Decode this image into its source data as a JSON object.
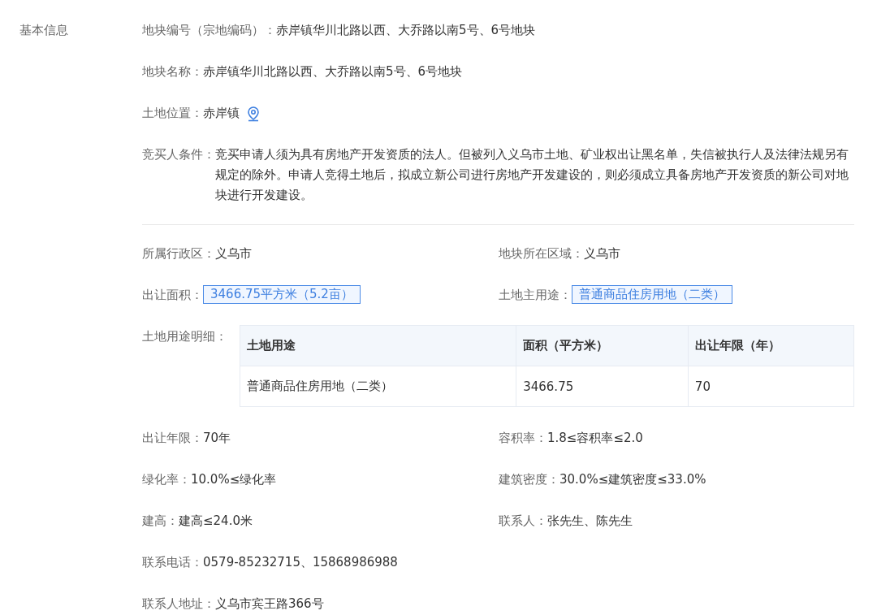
{
  "section_label": "基本信息",
  "top_fields": [
    {
      "label": "地块编号（宗地编码）：",
      "value": "赤岸镇华川北路以西、大乔路以南5号、6号地块",
      "kind": "text"
    },
    {
      "label": "地块名称：",
      "value": "赤岸镇华川北路以西、大乔路以南5号、6号地块",
      "kind": "text"
    },
    {
      "label": "土地位置：",
      "value": "赤岸镇",
      "kind": "location"
    },
    {
      "label": "竞买人条件：",
      "value": "竞买申请人须为具有房地产开发资质的法人。但被列入义乌市土地、矿业权出让黑名单，失信被执行人及法律法规另有规定的除外。申请人竞得土地后，拟成立新公司进行房地产开发建设的，则必须成立具备房地产开发资质的新公司对地块进行开发建设。",
      "kind": "text"
    }
  ],
  "grid_fields": [
    {
      "label": "所属行政区：",
      "value": "义乌市",
      "kind": "text",
      "wide": false
    },
    {
      "label": "地块所在区域：",
      "value": "义乌市",
      "kind": "text",
      "wide": false
    },
    {
      "label": "出让面积：",
      "value": "3466.75平方米（5.2亩）",
      "kind": "tag",
      "wide": false
    },
    {
      "label": "土地主用途：",
      "value": "普通商品住房用地（二类）",
      "kind": "tag",
      "wide": false
    }
  ],
  "usage_table": {
    "label": "土地用途明细：",
    "columns": [
      "土地用途",
      "面积（平方米）",
      "出让年限（年）"
    ],
    "rows": [
      [
        "普通商品住房用地（二类）",
        "3466.75",
        "70"
      ]
    ]
  },
  "more_fields": [
    {
      "label": "出让年限：",
      "value": "70年",
      "kind": "text",
      "wide": false
    },
    {
      "label": "容积率：",
      "value": "1.8≤容积率≤2.0",
      "kind": "text",
      "wide": false
    },
    {
      "label": "绿化率：",
      "value": "10.0%≤绿化率",
      "kind": "text",
      "wide": false
    },
    {
      "label": "建筑密度：",
      "value": "30.0%≤建筑密度≤33.0%",
      "kind": "text",
      "wide": false
    },
    {
      "label": "建高：",
      "value": "建高≤24.0米",
      "kind": "text",
      "wide": false
    },
    {
      "label": "联系人：",
      "value": "张先生、陈先生",
      "kind": "text",
      "wide": false
    },
    {
      "label": "联系电话：",
      "value": "0579-85232715、15868986988",
      "kind": "text",
      "wide": true
    },
    {
      "label": "联系人地址：",
      "value": "义乌市宾王路366号",
      "kind": "text",
      "wide": true
    }
  ]
}
